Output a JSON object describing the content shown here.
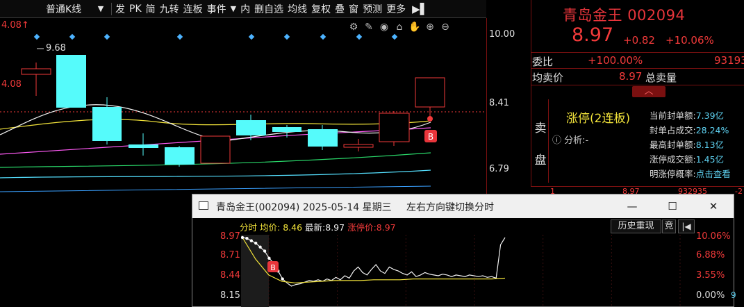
{
  "toolbar": {
    "period": "普通K线",
    "items": [
      "发",
      "PK",
      "简",
      "九转",
      "连板",
      "事件",
      "内",
      "删自选",
      "均线",
      "复权",
      "叠",
      "窗",
      "预测",
      "更多"
    ]
  },
  "kline": {
    "left_high_label": "4.08↑",
    "left_price": "4.08",
    "peak_marker": "9.68",
    "price_axis": [
      "10.00",
      "8.41",
      "6.79"
    ],
    "buy_badge": "B"
  },
  "quote": {
    "name": "青岛金王",
    "code": "002094",
    "price": "8.97",
    "change": "+0.82",
    "pct": "+10.06%",
    "ratio_label": "委比",
    "ratio_value": "+100.00%",
    "volume_value": "93193",
    "ask_avg_label": "均卖价",
    "ask_avg_value": "8.97",
    "total_ask_label": "总卖量",
    "sell_label_1": "卖",
    "sell_label_2": "盘",
    "limit_up_text": "涨停(2连板)",
    "analysis_text": "分析:-",
    "fields": [
      {
        "label": "当前封单额:",
        "value": "7.39亿"
      },
      {
        "label": "封单占成交:",
        "value": "28.24%"
      },
      {
        "label": "最高封单额:",
        "value": "8.13亿"
      },
      {
        "label": "涨停成交额:",
        "value": "1.45亿"
      },
      {
        "label": "明涨停概率:",
        "value": "点击查看"
      }
    ],
    "bottom_row": [
      "1",
      "8.97",
      "932935",
      "-2"
    ]
  },
  "popup": {
    "title": "青岛金王(002094) 2025-05-14 星期三",
    "hint": "左右方向键切换分时",
    "bar": {
      "mode": "分时",
      "avg_label": "均价:",
      "avg_value": "8.46",
      "last_label": "最新:",
      "last_value": "8.97",
      "limit_label": "涨停价:",
      "limit_value": "8.97"
    },
    "history_button": "历史重现",
    "bid_button": "竞",
    "left_axis": [
      "8.97",
      "8.71",
      "8.44",
      "8.15"
    ],
    "right_axis": [
      "10.06%",
      "6.88%",
      "3.55%",
      "0.00%"
    ],
    "buy_badge": "B",
    "right_edge_digit": "9"
  },
  "colors": {
    "up": "#f23a3a",
    "cyan": "#55fbfb",
    "accent_red": "#7a1010"
  },
  "chart_data": {
    "type": "line",
    "title": "",
    "x_range": [
      0,
      240
    ],
    "y_range": [
      8.15,
      8.97
    ],
    "series": [
      {
        "values": [
          8.97,
          8.96,
          8.93,
          8.9,
          8.85,
          8.8,
          8.71,
          8.65,
          8.55,
          8.45,
          8.4,
          8.36,
          8.38,
          8.39,
          8.41,
          8.43,
          8.42,
          8.44,
          8.42,
          8.45,
          8.43,
          8.47,
          8.44,
          8.49,
          8.46,
          8.55,
          8.6,
          8.53,
          8.5,
          8.57,
          8.63,
          8.55,
          8.52,
          8.6,
          8.57,
          8.55,
          8.52,
          8.5,
          8.54,
          8.48,
          8.5,
          8.53,
          8.51,
          8.5,
          8.49,
          8.51,
          8.5,
          8.48,
          8.5,
          8.49,
          8.48,
          8.5,
          8.49,
          8.48,
          8.49,
          8.47,
          8.48,
          8.46,
          8.88,
          8.97
        ]
      },
      {
        "values": [
          8.97,
          8.7,
          8.5,
          8.42,
          8.4,
          8.41,
          8.42,
          8.43,
          8.43,
          8.43,
          8.44,
          8.44,
          8.44,
          8.45,
          8.45,
          8.45,
          8.45,
          8.45,
          8.45,
          8.45,
          8.46
        ]
      }
    ]
  }
}
